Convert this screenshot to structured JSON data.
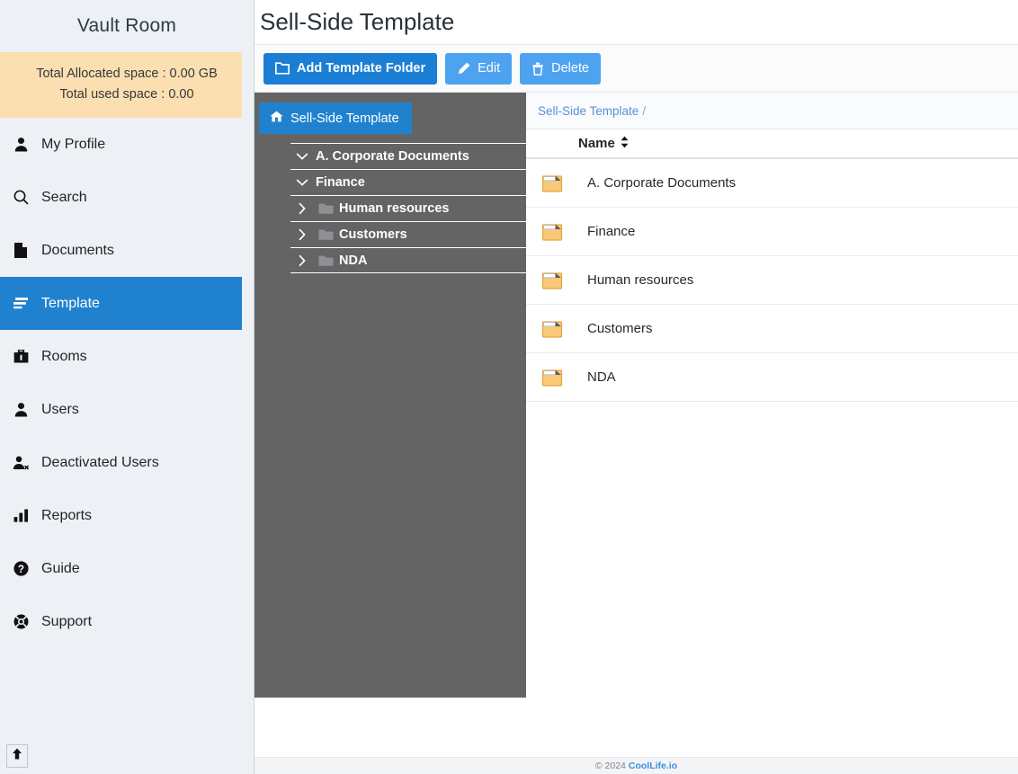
{
  "sidebar": {
    "brand": "Vault Room",
    "storage": {
      "allocated": "Total Allocated space : 0.00 GB",
      "used": "Total used space : 0.00"
    },
    "items": [
      {
        "label": "My Profile",
        "icon": "user-icon",
        "active": false
      },
      {
        "label": "Search",
        "icon": "search-icon",
        "active": false
      },
      {
        "label": "Documents",
        "icon": "document-icon",
        "active": false
      },
      {
        "label": "Template",
        "icon": "template-icon",
        "active": true
      },
      {
        "label": "Rooms",
        "icon": "briefcase-icon",
        "active": false
      },
      {
        "label": "Users",
        "icon": "user-icon",
        "active": false
      },
      {
        "label": "Deactivated Users",
        "icon": "user-times-icon",
        "active": false
      },
      {
        "label": "Reports",
        "icon": "bar-chart-icon",
        "active": false
      },
      {
        "label": "Guide",
        "icon": "question-circle-icon",
        "active": false
      },
      {
        "label": "Support",
        "icon": "life-ring-icon",
        "active": false
      }
    ],
    "scroll_top_icon": "arrow-up-icon"
  },
  "header": {
    "title": "Sell-Side Template"
  },
  "toolbar": {
    "add_folder_label": "Add Template Folder",
    "add_folder_icon": "folder-icon",
    "edit_label": "Edit",
    "edit_icon": "pencil-icon",
    "delete_label": "Delete",
    "delete_icon": "trash-icon"
  },
  "tree": {
    "root_label": "Sell-Side Template",
    "root_icon": "home-icon",
    "items": [
      {
        "label": "A. Corporate Documents",
        "expanded": true,
        "has_folder_icon": false,
        "chevron": "chevron-down-icon"
      },
      {
        "label": "Finance",
        "expanded": true,
        "has_folder_icon": false,
        "chevron": "chevron-down-icon"
      },
      {
        "label": "Human resources",
        "expanded": false,
        "has_folder_icon": true,
        "chevron": "chevron-right-icon"
      },
      {
        "label": "Customers",
        "expanded": false,
        "has_folder_icon": true,
        "chevron": "chevron-right-icon"
      },
      {
        "label": "NDA",
        "expanded": false,
        "has_folder_icon": true,
        "chevron": "chevron-right-icon"
      }
    ]
  },
  "files": {
    "breadcrumb": {
      "root": "Sell-Side Template",
      "separator": "/"
    },
    "column_header": "Name",
    "sort_icon": "sort-updown-icon",
    "rows": [
      {
        "name": "A. Corporate Documents",
        "icon": "folder-icon"
      },
      {
        "name": "Finance",
        "icon": "folder-icon"
      },
      {
        "name": "Human resources",
        "icon": "folder-icon"
      },
      {
        "name": "Customers",
        "icon": "folder-icon"
      },
      {
        "name": "NDA",
        "icon": "folder-icon"
      }
    ]
  },
  "footer": {
    "copyright": "© 2024",
    "brand": "CoolLife.io"
  },
  "colors": {
    "accent_blue": "#2082cf",
    "button_blue": "#1a7fd4",
    "button_light_blue": "#4da3ef",
    "sidebar_bg": "#edf1f5",
    "storage_bg": "#fcdfb0",
    "tree_bg": "#646464",
    "folder_orange": "#f9c978",
    "link_blue": "#5b8fd6"
  }
}
